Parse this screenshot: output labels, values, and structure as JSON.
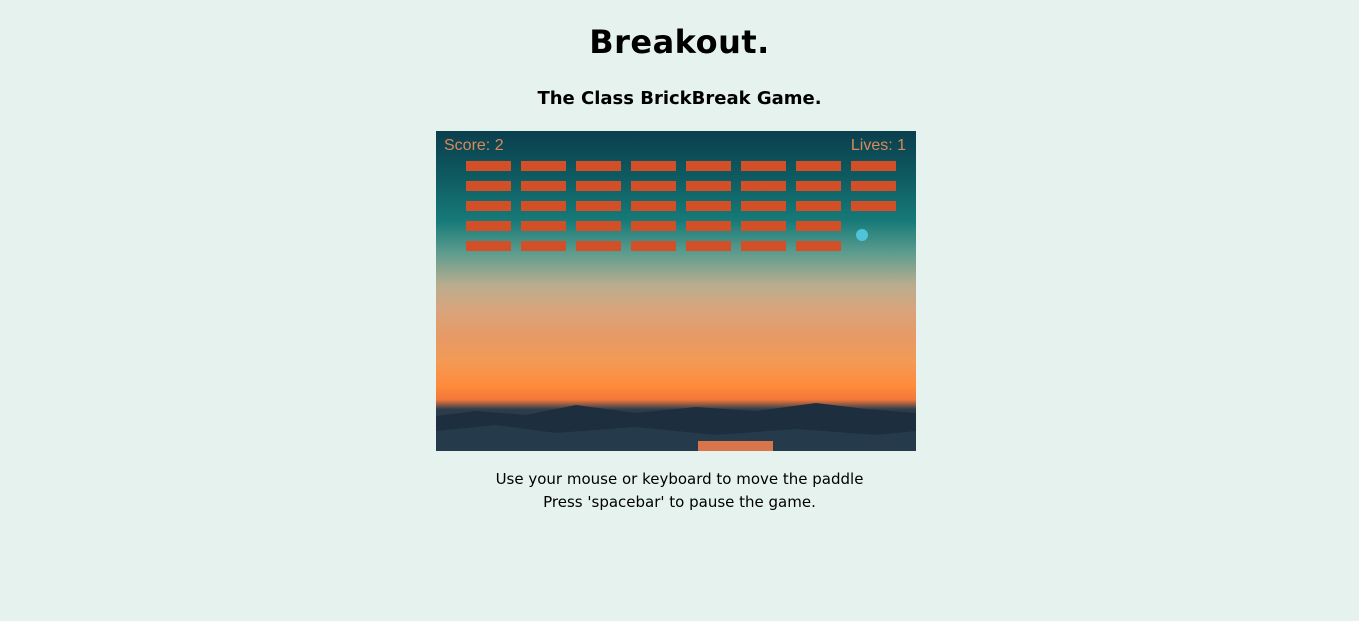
{
  "header": {
    "title": "Breakout.",
    "subtitle": "The Class BrickBreak Game."
  },
  "game": {
    "score_text": "Score: 2",
    "lives_text": "Lives: 1",
    "colors": {
      "brick": "#d24f28",
      "ball": "#4fc3d9",
      "paddle": "#d9754a",
      "hud_text": "#d98a5a"
    },
    "brick_grid": {
      "columns": 8,
      "rows": 5,
      "broken": [
        [
          3,
          7
        ],
        [
          4,
          7
        ]
      ]
    }
  },
  "instructions": {
    "line1": "Use your mouse or keyboard to move the paddle",
    "line2": "Press 'spacebar' to pause the game."
  }
}
